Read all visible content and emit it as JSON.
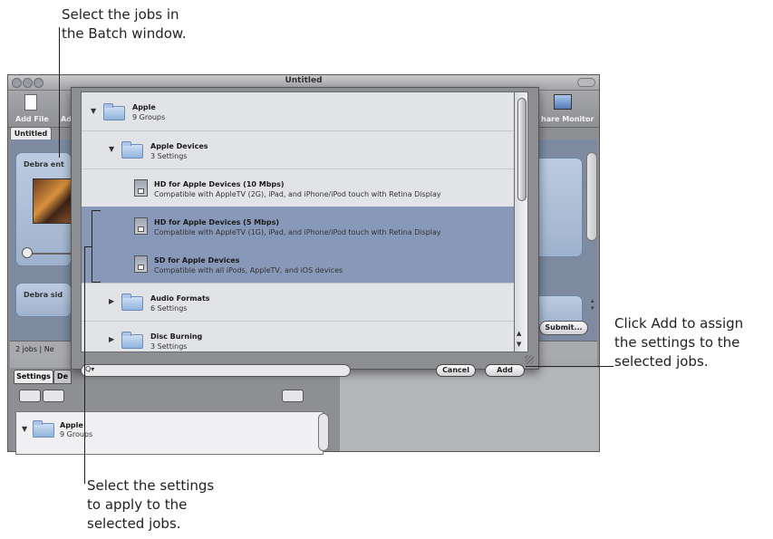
{
  "window": {
    "title": "Untitled"
  },
  "toolbar": {
    "add_file": "Add File",
    "add_partial": "Ad",
    "share_monitor": "hare Monitor"
  },
  "batch": {
    "tab": "Untitled",
    "job1_title": "Debra ent",
    "job2_title": "Debra sid",
    "status": "2 jobs  |  Ne",
    "submit": "Submit..."
  },
  "lower": {
    "tab_settings": "Settings",
    "tab_other": "De",
    "group_title": "Apple",
    "group_sub": "9 Groups"
  },
  "sheet": {
    "rows": [
      {
        "title": "Apple",
        "sub": "9 Groups"
      },
      {
        "title": "Apple Devices",
        "sub": "3 Settings"
      },
      {
        "title": "HD for Apple Devices (10 Mbps)",
        "sub": "Compatible with AppleTV (2G), iPad, and iPhone/iPod touch with Retina Display"
      },
      {
        "title": "HD for Apple Devices (5 Mbps)",
        "sub": "Compatible with AppleTV (1G), iPad, and iPhone/iPod touch with Retina Display"
      },
      {
        "title": "SD for Apple Devices",
        "sub": "Compatible with all iPods, AppleTV, and iOS devices"
      },
      {
        "title": "Audio Formats",
        "sub": "6 Settings"
      },
      {
        "title": "Disc Burning",
        "sub": "3 Settings"
      }
    ],
    "cancel": "Cancel",
    "add": "Add",
    "search_glyph": "Q▾"
  },
  "callouts": {
    "top": "Select the jobs in\nthe Batch window.",
    "right": "Click Add to assign\nthe settings to the\nselected jobs.",
    "bottom": "Select the settings\nto apply to the\nselected jobs."
  },
  "icons": [
    "folder-icon",
    "settings-document-icon",
    "disclosure-triangle-icon",
    "search-icon"
  ]
}
